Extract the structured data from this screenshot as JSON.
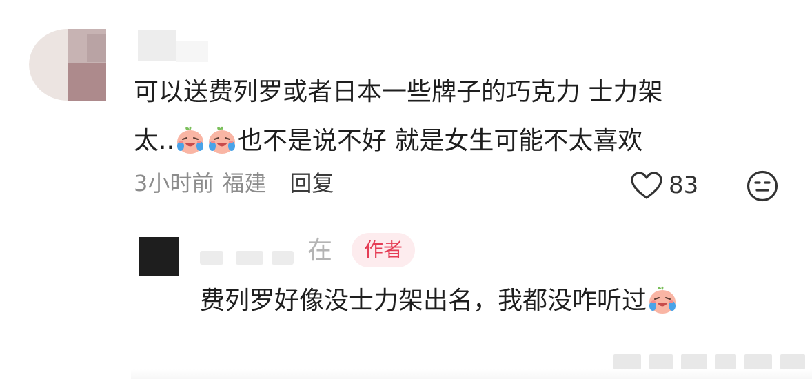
{
  "comment": {
    "line1": "可以送费列罗或者日本一些牌子的巧克力 士力架",
    "line2_start": "太..",
    "line2_end": "也不是说不好 就是女生可能不太喜欢",
    "emoji_name": "crying-laughing-peach-emoji",
    "time": "3小时前",
    "region": "福建",
    "reply_label": "回复",
    "like_count": "83",
    "icons": {
      "like": "heart-outline-icon",
      "dislike": "meh-face-icon"
    }
  },
  "reply": {
    "name_suffix": "在",
    "author_badge": "作者",
    "text": "费列罗好像没士力架出名，我都没咋听过"
  },
  "colors": {
    "text": "#1e1e1e",
    "meta": "#8c8c8c",
    "badge_bg": "#fdecee",
    "badge_text": "#e53d55"
  }
}
